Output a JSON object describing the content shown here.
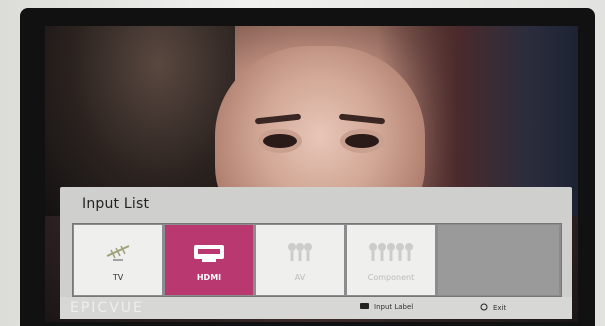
{
  "osd": {
    "title": "Input List",
    "sources": [
      {
        "label": "TV",
        "icon": "antenna-icon",
        "state": "normal"
      },
      {
        "label": "HDMI",
        "icon": "hdmi-icon",
        "state": "selected"
      },
      {
        "label": "AV",
        "icon": "av-jacks-icon",
        "state": "faded"
      },
      {
        "label": "Component",
        "icon": "component-jacks-icon",
        "state": "faded"
      }
    ],
    "hints": {
      "input_label": "Input Label",
      "exit": "Exit"
    },
    "watermark": "EPICVUE",
    "colors": {
      "selected": "#b8386f",
      "panel": "#cfcfcd"
    }
  }
}
